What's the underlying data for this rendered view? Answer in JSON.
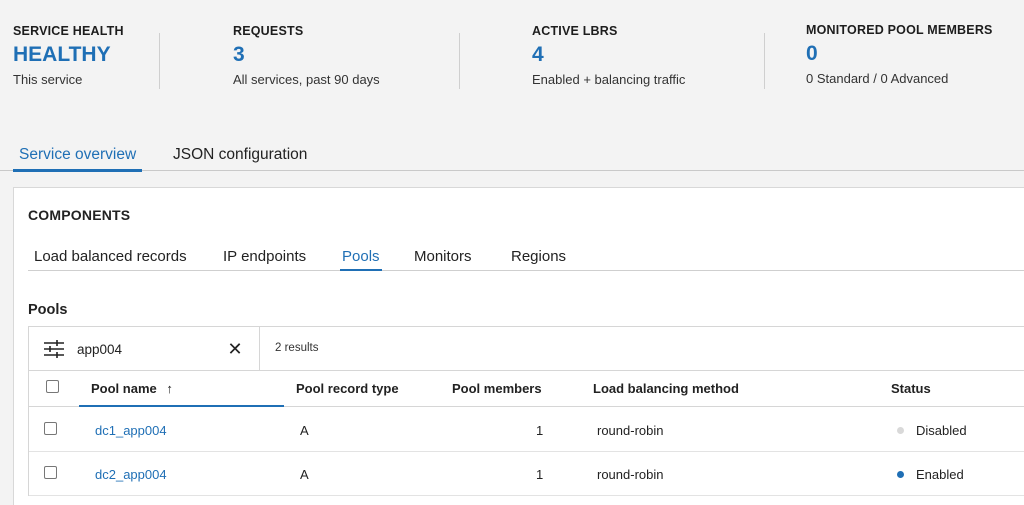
{
  "stats": [
    {
      "label": "SERVICE HEALTH",
      "value": "HEALTHY",
      "sub": "This service"
    },
    {
      "label": "REQUESTS",
      "value": "3",
      "sub": "All services, past 90 days"
    },
    {
      "label": "ACTIVE LBRS",
      "value": "4",
      "sub": "Enabled + balancing traffic"
    },
    {
      "label": "MONITORED POOL MEMBERS",
      "value": "0",
      "sub": "0 Standard / 0 Advanced"
    }
  ],
  "page_tabs": {
    "overview": "Service overview",
    "json": "JSON configuration",
    "active": "Service overview"
  },
  "components": {
    "title": "COMPONENTS",
    "tabs": [
      "Load balanced records",
      "IP endpoints",
      "Pools",
      "Monitors",
      "Regions"
    ],
    "active_tab": "Pools"
  },
  "pools": {
    "title": "Pools",
    "search_value": "app004",
    "results": "2 results",
    "columns": {
      "name": "Pool name",
      "sort_indicator": "↑",
      "record_type": "Pool record type",
      "members": "Pool members",
      "method": "Load balancing method",
      "status": "Status"
    },
    "rows": [
      {
        "name": "dc1_app004",
        "record_type": "A",
        "members": "1",
        "method": "round-robin",
        "status": "Disabled",
        "status_color": "#d9d9d9"
      },
      {
        "name": "dc2_app004",
        "record_type": "A",
        "members": "1",
        "method": "round-robin",
        "status": "Enabled",
        "status_color": "#1f6fb5"
      }
    ]
  },
  "colors": {
    "accent": "#1f6fb5",
    "disabled_dot": "#d9d9d9"
  },
  "icons": {
    "filter": "sliders-icon",
    "clear": "close-icon",
    "sort": "arrow-up-icon"
  }
}
